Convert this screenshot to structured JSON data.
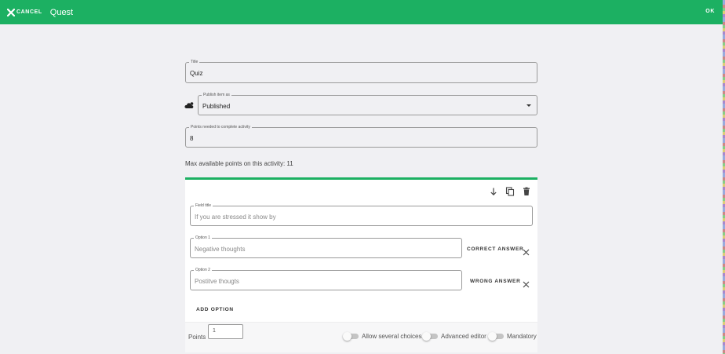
{
  "header": {
    "cancel_label": "CANCEL",
    "title": "Quest",
    "ok_label": "OK",
    "bg_color": "#1cb062"
  },
  "form": {
    "title_field": {
      "legend": "Title",
      "value": "Quiz"
    },
    "publish_field": {
      "legend": "Publish item as",
      "value": "Published"
    },
    "points_needed_field": {
      "legend": "Points needed to complete activity",
      "value": "8"
    },
    "max_points_text": "Max available points on this activity: 11"
  },
  "question_card": {
    "field_title": {
      "legend": "Field title",
      "value": "If you are stressed it show by"
    },
    "options": [
      {
        "legend": "Option 1",
        "value": "Negative thoughts",
        "answer_label": "CORRECT ANSWER"
      },
      {
        "legend": "Option 2",
        "value": "Postitve thougts",
        "answer_label": "WRONG ANSWER"
      }
    ],
    "add_option_label": "ADD OPTION",
    "points_label": "Points",
    "points_value": "1",
    "toggles": {
      "several_choices": "Allow several choices",
      "advanced_editor": "Advanced editor",
      "mandatory": "Mandatory"
    }
  },
  "icons": [
    "close-icon",
    "cloud-visibility-icon",
    "dropdown-arrow-icon",
    "move-down-icon",
    "copy-icon",
    "delete-icon",
    "remove-option-icon"
  ]
}
